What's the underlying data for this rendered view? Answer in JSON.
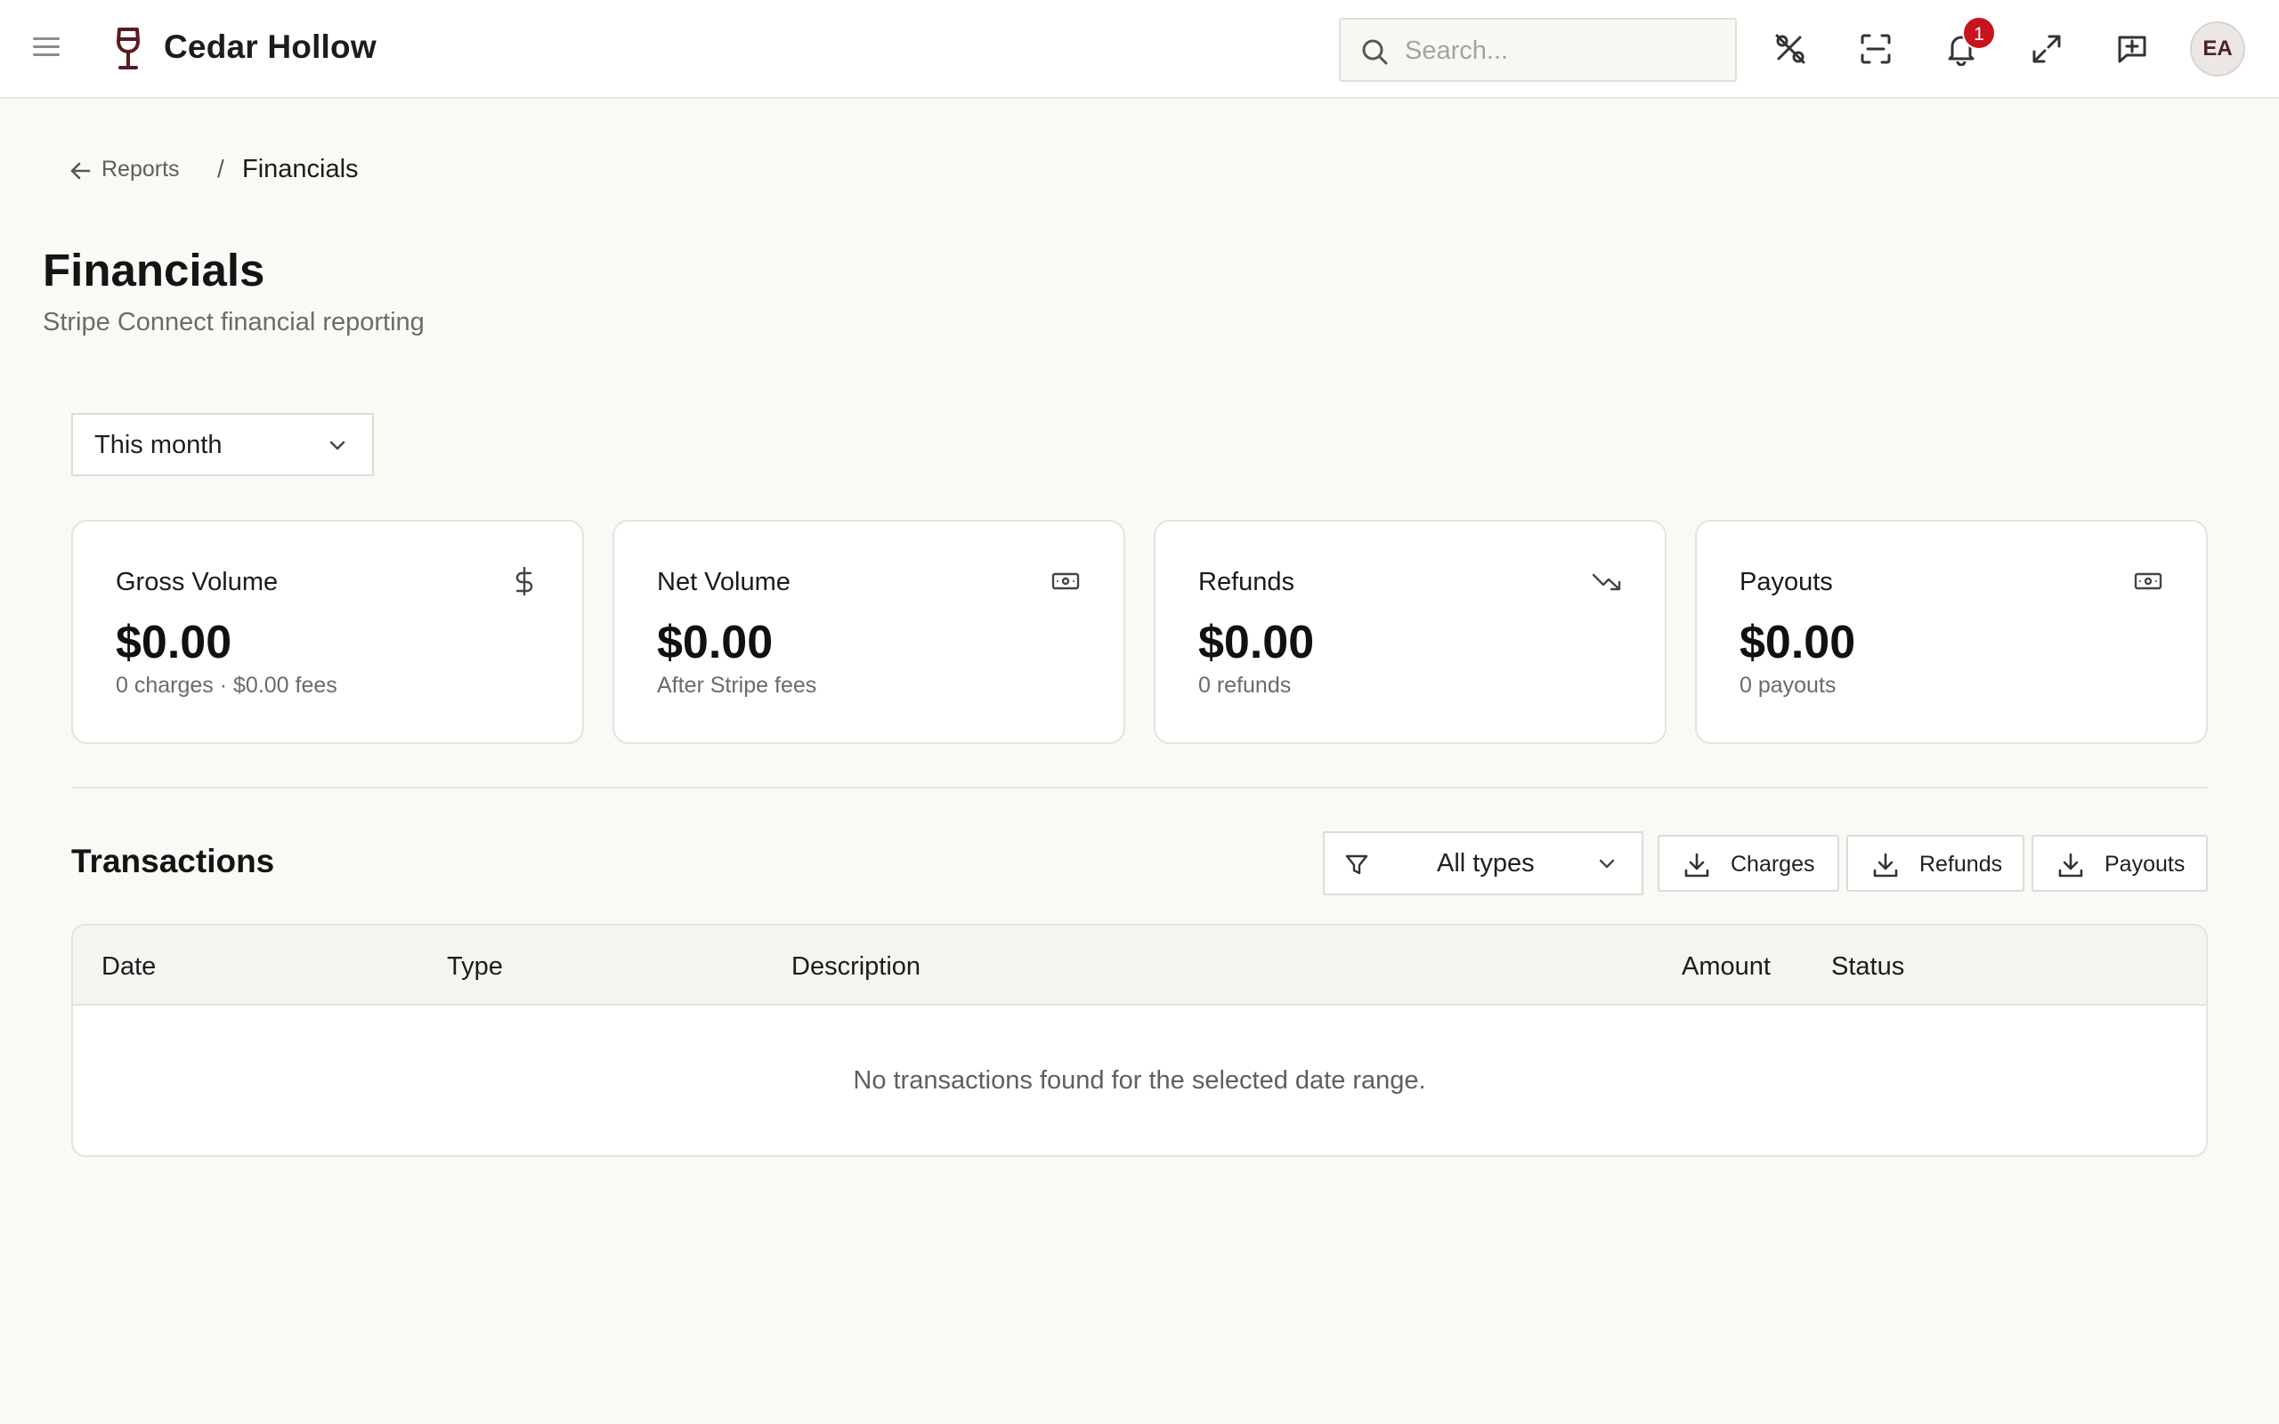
{
  "app": {
    "title": "Cedar Hollow",
    "brand_color": "#5a1a22"
  },
  "search": {
    "placeholder": "Search..."
  },
  "topbar_icons": [
    "percent-off-icon",
    "scan-icon",
    "bell-icon",
    "expand-icon",
    "feedback-icon"
  ],
  "notifications": {
    "count": "1"
  },
  "user": {
    "initials": "EA"
  },
  "breadcrumb": {
    "back_label": "Reports",
    "separator": "/",
    "current": "Financials"
  },
  "page": {
    "title": "Financials",
    "subtitle": "Stripe Connect financial reporting"
  },
  "date_filter": {
    "selected": "This month"
  },
  "cards": [
    {
      "label": "Gross Volume",
      "value": "$0.00",
      "sub": "0 charges · $0.00 fees",
      "icon": "dollar-icon"
    },
    {
      "label": "Net Volume",
      "value": "$0.00",
      "sub": "After Stripe fees",
      "icon": "banknote-icon"
    },
    {
      "label": "Refunds",
      "value": "$0.00",
      "sub": "0 refunds",
      "icon": "trending-down-icon"
    },
    {
      "label": "Payouts",
      "value": "$0.00",
      "sub": "0 payouts",
      "icon": "banknote-icon"
    }
  ],
  "transactions": {
    "title": "Transactions",
    "type_filter": "All types",
    "export_buttons": [
      "Charges",
      "Refunds",
      "Payouts"
    ],
    "columns": [
      "Date",
      "Type",
      "Description",
      "Amount",
      "Status"
    ],
    "rows": [],
    "empty_message": "No transactions found for the selected date range."
  }
}
